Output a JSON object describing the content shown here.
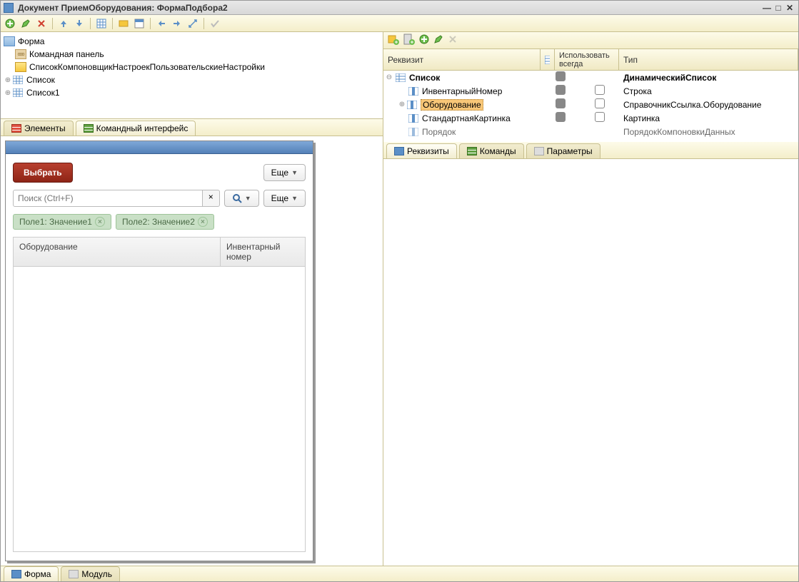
{
  "window": {
    "title": "Документ ПриемОборудования: ФормаПодбора2"
  },
  "lefttree": {
    "root": "Форма",
    "items": [
      {
        "label": "Командная панель"
      },
      {
        "label": "СписокКомпоновщикНастроекПользовательскиеНастройки"
      },
      {
        "label": "Список"
      },
      {
        "label": "Список1"
      }
    ]
  },
  "lefttabs": {
    "t1": "Элементы",
    "t2": "Командный интерфейс"
  },
  "rightgrid": {
    "h1": "Реквизит",
    "h2": "Использовать всегда",
    "h3": "Тип",
    "rows": [
      {
        "label": "Список",
        "type": "ДинамическийСписок",
        "bold": true
      },
      {
        "label": "ИнвентарныйНомер",
        "type": "Строка"
      },
      {
        "label": "Оборудование",
        "type": "СправочникСсылка.Оборудование",
        "selected": true
      },
      {
        "label": "СтандартнаяКартинка",
        "type": "Картинка"
      },
      {
        "label": "Порядок",
        "type": "ПорядокКомпоновкиДанных"
      }
    ]
  },
  "righttabs": {
    "t1": "Реквизиты",
    "t2": "Команды",
    "t3": "Параметры"
  },
  "preview": {
    "select_btn": "Выбрать",
    "more_btn": "Еще",
    "search_placeholder": "Поиск (Ctrl+F)",
    "filters": {
      "f1": "Поле1: Значение1",
      "f2": "Поле2: Значение2"
    },
    "table": {
      "col1": "Оборудование",
      "col2": "Инвентарный номер"
    }
  },
  "bottomtabs": {
    "t1": "Форма",
    "t2": "Модуль"
  }
}
